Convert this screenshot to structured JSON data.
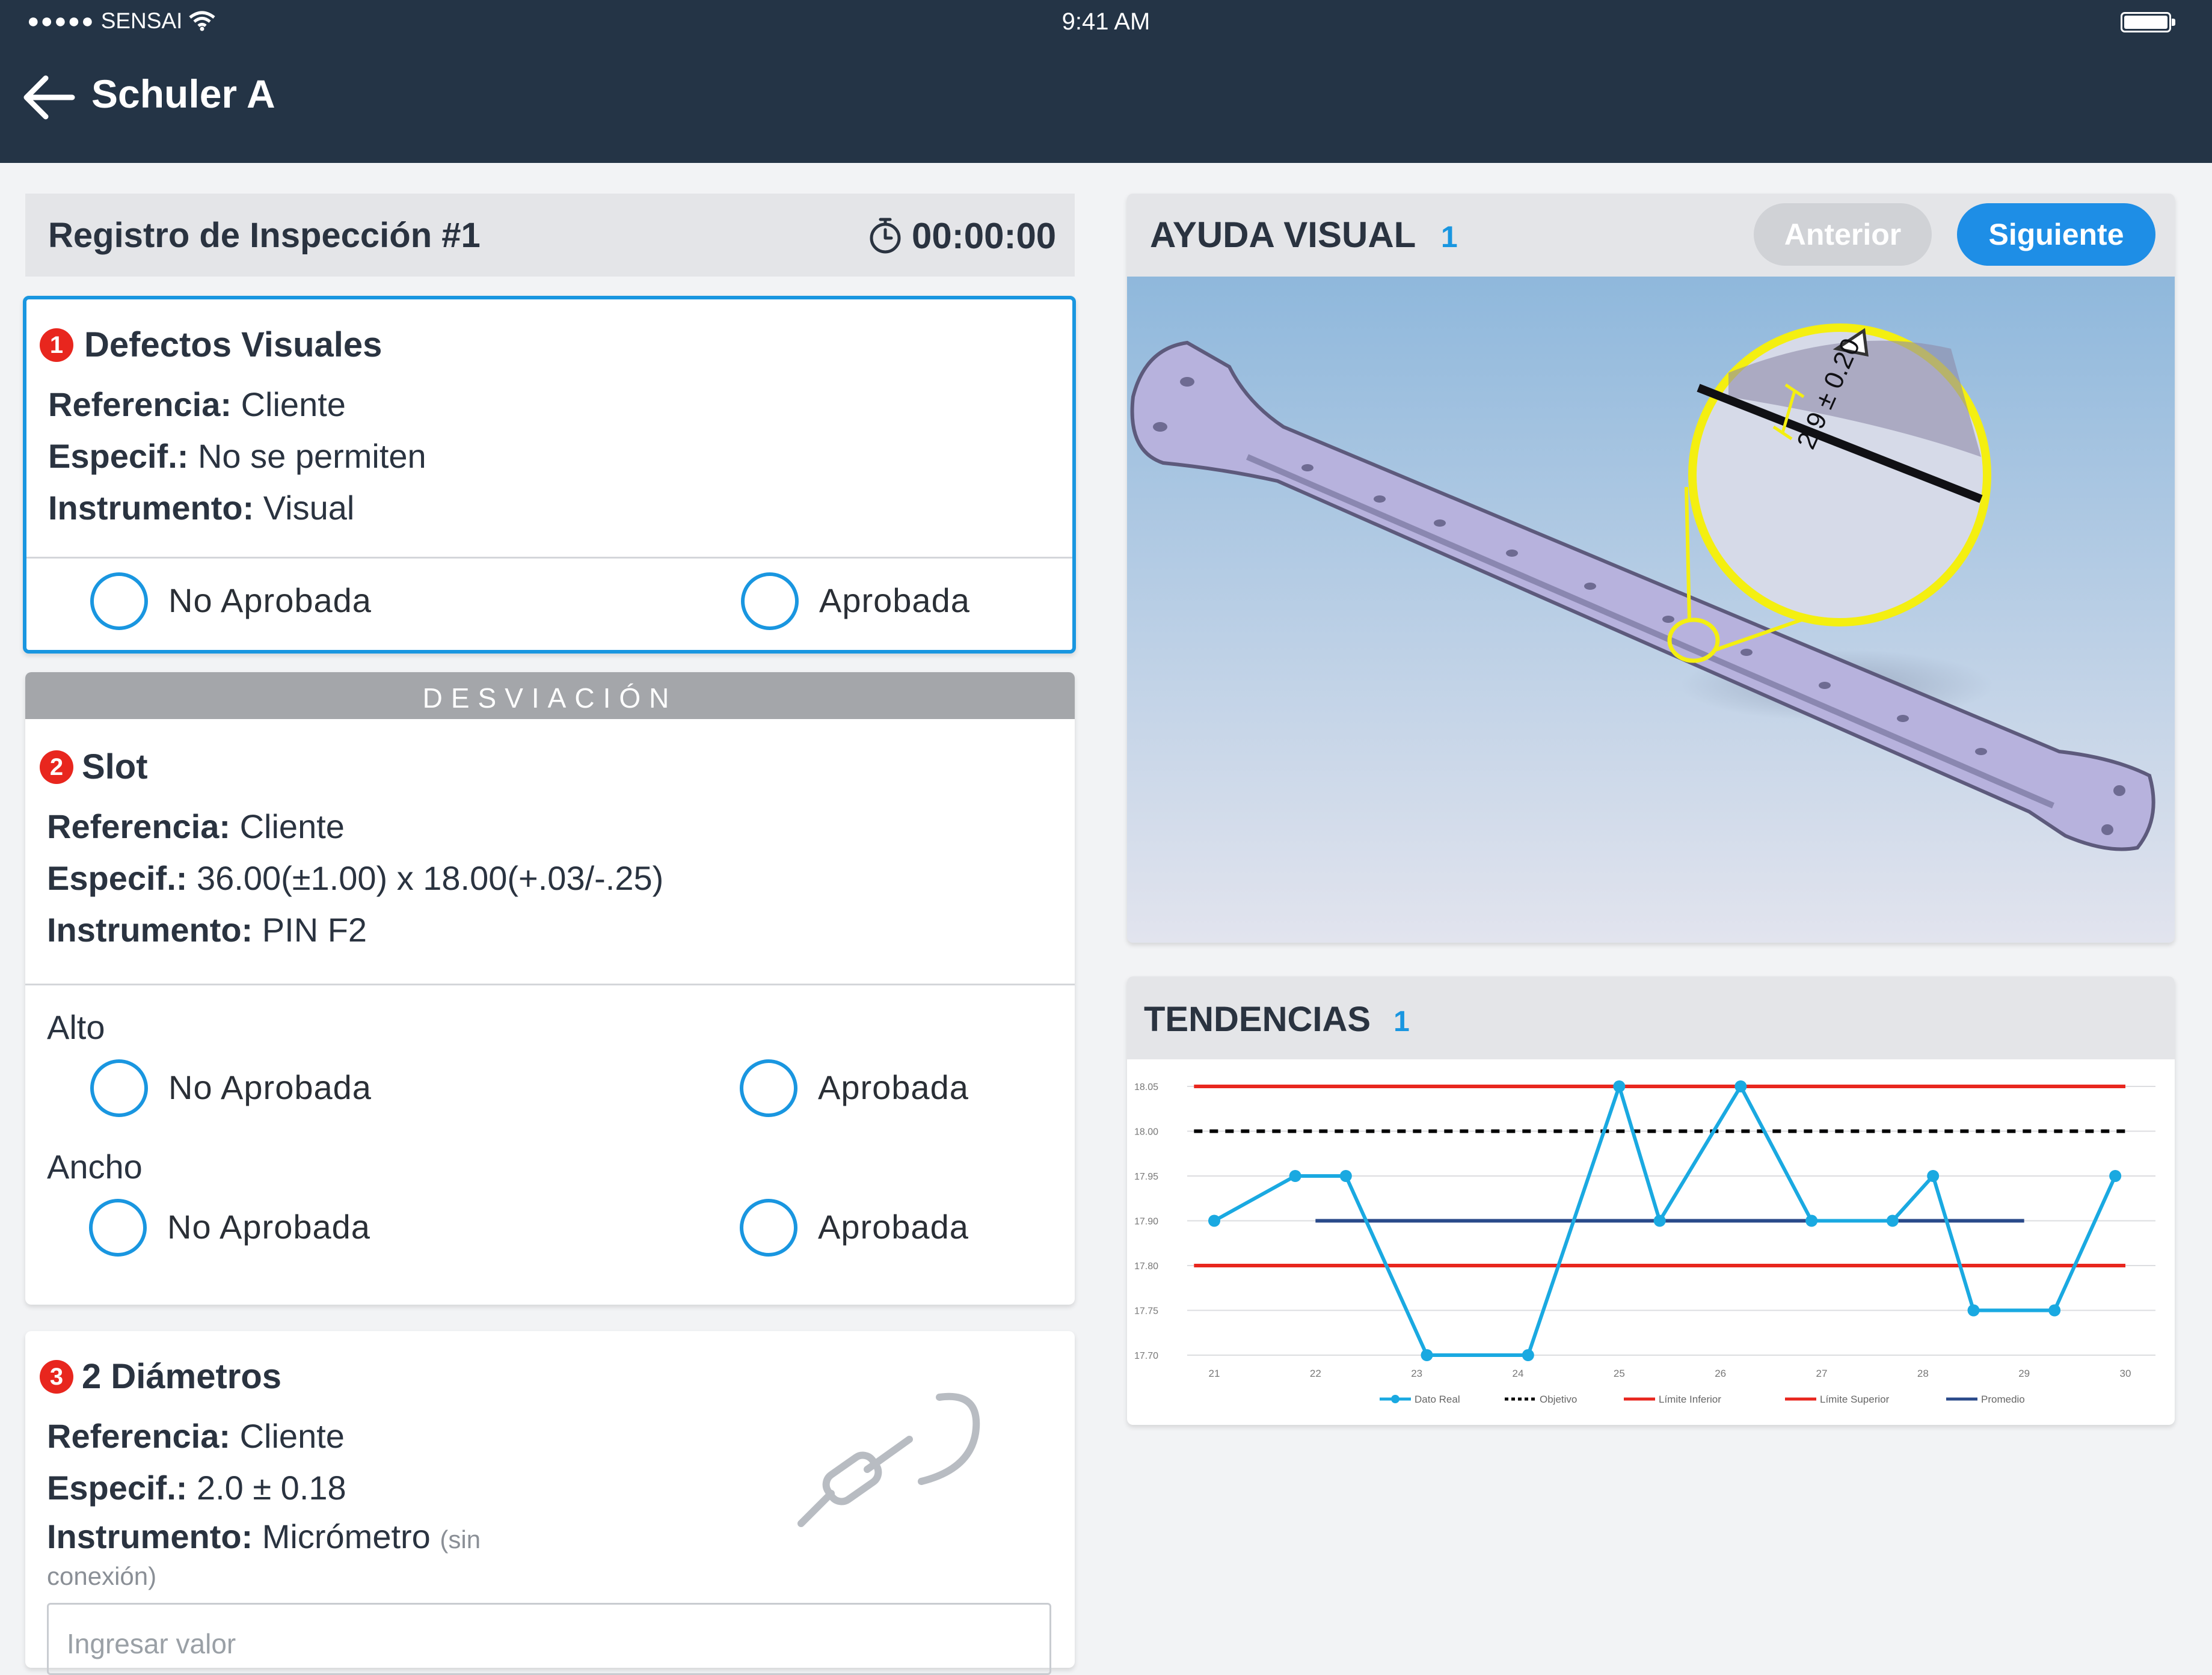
{
  "status_bar": {
    "carrier": "SENSAI",
    "time": "9:41 AM"
  },
  "nav": {
    "title": "Schuler A"
  },
  "inspection": {
    "title": "Registro de Inspección #1",
    "timer": "00:00:00"
  },
  "item1": {
    "number": "1",
    "title": "Defectos Visuales",
    "ref_label": "Referencia:",
    "ref_value": "Cliente",
    "spec_label": "Especif.:",
    "spec_value": "No se permiten",
    "inst_label": "Instrumento:",
    "inst_value": "Visual",
    "reject_label": "No Aprobada",
    "approve_label": "Aprobada"
  },
  "deviation_banner": "DESVIACIÓN",
  "item2": {
    "number": "2",
    "title": "Slot",
    "ref_label": "Referencia:",
    "ref_value": "Cliente",
    "spec_label": "Especif.:",
    "spec_value": "36.00(±1.00) x 18.00(+.03/-.25)",
    "inst_label": "Instrumento:",
    "inst_value": "PIN F2",
    "alto_label": "Alto",
    "ancho_label": "Ancho",
    "reject_label": "No Aprobada",
    "approve_label": "Aprobada"
  },
  "item3": {
    "number": "3",
    "title": "2 Diámetros",
    "ref_label": "Referencia:",
    "ref_value": "Cliente",
    "spec_label": "Especif.:",
    "spec_value": "2.0 ± 0.18",
    "inst_label": "Instrumento:",
    "inst_value": "Micrómetro",
    "inst_note": "(sin conexión)",
    "input_placeholder": "Ingresar valor"
  },
  "visual_aid": {
    "title": "AYUDA VISUAL",
    "count": "1",
    "prev_label": "Anterior",
    "next_label": "Siguiente",
    "dimension_label": "2.9 ± 0.20"
  },
  "trends": {
    "title": "TENDENCIAS",
    "count": "1"
  },
  "colors": {
    "header_bg": "#243446",
    "accent": "#1996e0",
    "badge": "#e8261e",
    "series_real": "#1aa9e1",
    "series_objetivo": "#000000",
    "series_limits": "#e8261e",
    "series_promedio": "#2a4a8a"
  },
  "chart_data": {
    "type": "line",
    "x": [
      21,
      21.8,
      22.3,
      23.1,
      24.1,
      25.0,
      25.4,
      26.2,
      26.9,
      27.7,
      28.1,
      28.5,
      29.3,
      29.9
    ],
    "x_ticks": [
      "21",
      "22",
      "23",
      "24",
      "25",
      "26",
      "27",
      "28",
      "29",
      "30"
    ],
    "y_ticks": [
      "17.70",
      "17.75",
      "17.80",
      "17.90",
      "17.95",
      "18.00",
      "18.05"
    ],
    "ylim": [
      "17.70",
      "18.05"
    ],
    "series": [
      {
        "name": "Dato Real",
        "values": [
          "17.90",
          "17.95",
          "17.95",
          "17.70",
          "17.70",
          "18.05",
          "17.90",
          "18.05",
          "17.90",
          "17.90",
          "17.95",
          "17.75",
          "17.75",
          "17.95"
        ]
      },
      {
        "name": "Objetivo",
        "value": "18.00"
      },
      {
        "name": "Límite Inferior",
        "value": "17.80"
      },
      {
        "name": "Límite Superior",
        "value": "18.05"
      },
      {
        "name": "Promedio",
        "value": "17.90",
        "x_range": [
          22,
          29
        ]
      }
    ],
    "legend_position": "bottom",
    "grid": true
  }
}
